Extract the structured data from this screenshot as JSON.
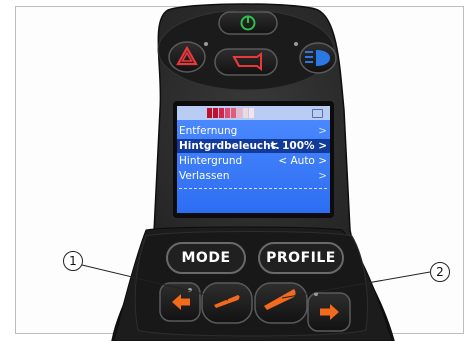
{
  "display": {
    "menu": [
      {
        "label": "Entfernung",
        "value": "",
        "arrow": ">"
      },
      {
        "label": "Hintgrdbeleucht.",
        "value": "< 100% >",
        "arrow": ""
      },
      {
        "label": "Hintergrund",
        "value": "< Auto >",
        "arrow": ""
      },
      {
        "label": "Verlassen",
        "value": "",
        "arrow": ">"
      }
    ],
    "selected_index": 1,
    "battery_colors": [
      "#c0102a",
      "#c0102a",
      "#d6244a",
      "#e24a6c",
      "#e45c7a",
      "#e8b8c6",
      "#f0d8e0",
      "#f4e4ea"
    ]
  },
  "buttons": {
    "mode_label": "MODE",
    "profile_label": "PROFILE"
  },
  "callouts": {
    "first": "1",
    "second": "2"
  },
  "colors": {
    "accent_orange": "#f26a1b",
    "power_green": "#2fc04a",
    "hazard_red": "#e8383a",
    "light_blue": "#2b78e4"
  }
}
